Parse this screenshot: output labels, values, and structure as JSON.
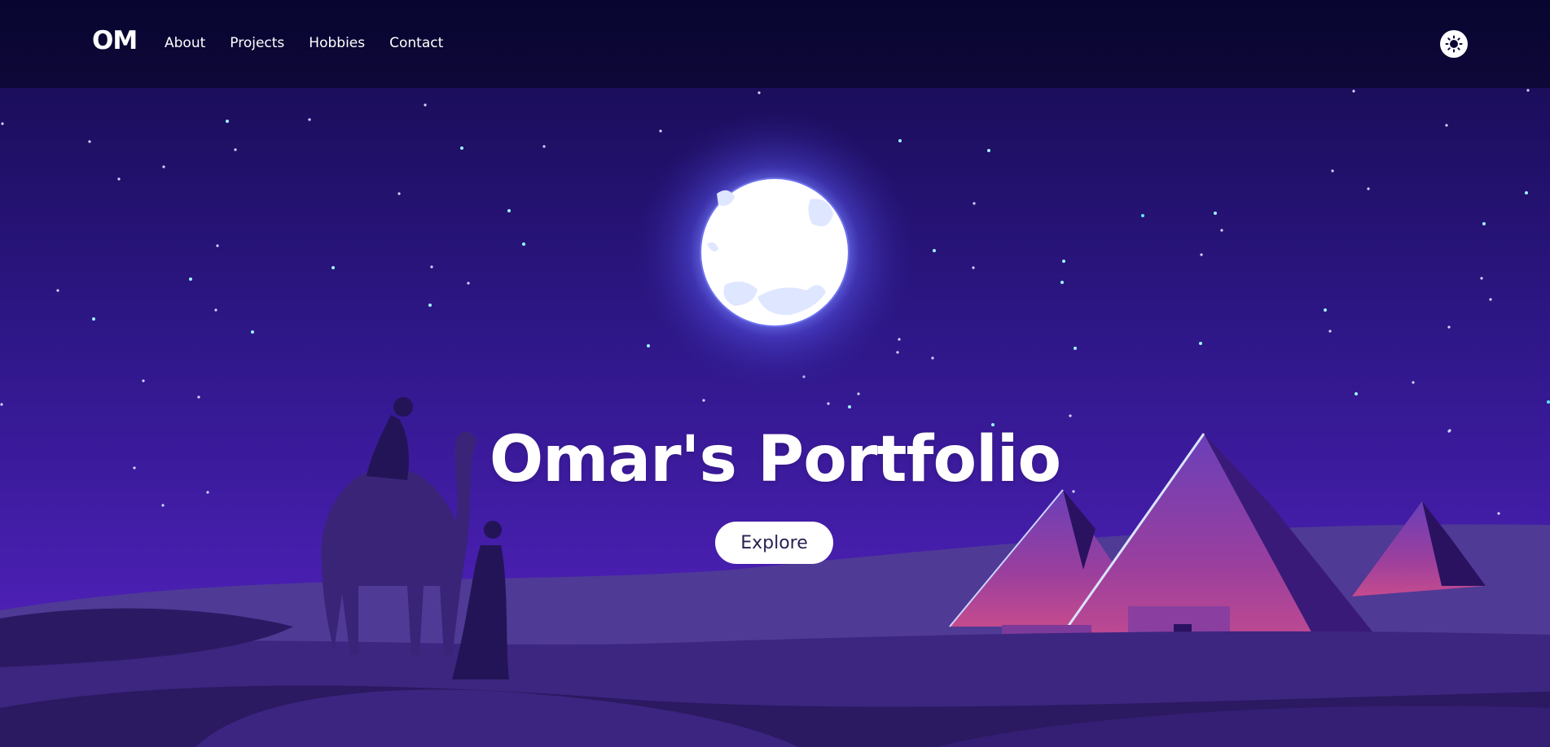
{
  "header": {
    "logo": "OM",
    "nav": [
      {
        "label": "About"
      },
      {
        "label": "Projects"
      },
      {
        "label": "Hobbies"
      },
      {
        "label": "Contact"
      }
    ],
    "theme_toggle_icon": "sun-icon"
  },
  "hero": {
    "title": "Omar's Portfolio",
    "cta_label": "Explore"
  },
  "colors": {
    "nav_bg": "#0b0634",
    "sky_top": "#170a4e",
    "sky_bottom": "#4a1fb2",
    "accent_text": "#ffffff",
    "button_text": "#2a1f52"
  }
}
